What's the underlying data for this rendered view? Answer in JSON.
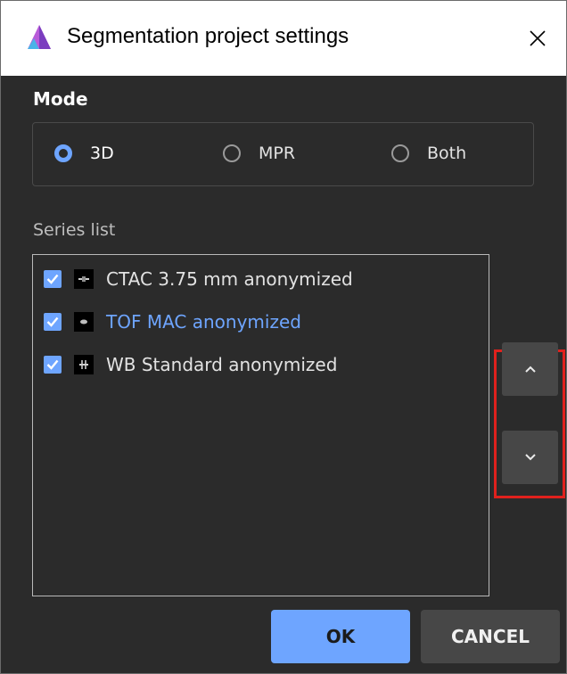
{
  "window": {
    "title": "Segmentation project settings",
    "close_symbol": "✕"
  },
  "mode": {
    "label": "Mode",
    "options": [
      "3D",
      "MPR",
      "Both"
    ],
    "selected": "3D"
  },
  "series": {
    "label": "Series list",
    "items": [
      {
        "label": "CTAC 3.75 mm anonymized",
        "checked": true,
        "selected": false
      },
      {
        "label": "TOF MAC anonymized",
        "checked": true,
        "selected": true
      },
      {
        "label": "WB Standard anonymized",
        "checked": true,
        "selected": false
      }
    ]
  },
  "order_controls": {
    "up_icon": "chevron-up-icon",
    "down_icon": "chevron-down-icon"
  },
  "footer": {
    "ok_label": "OK",
    "cancel_label": "CANCEL"
  },
  "colors": {
    "accent": "#6ea5ff",
    "background": "#2b2b2b",
    "button_secondary": "#474747",
    "highlight": "#e0211d"
  }
}
